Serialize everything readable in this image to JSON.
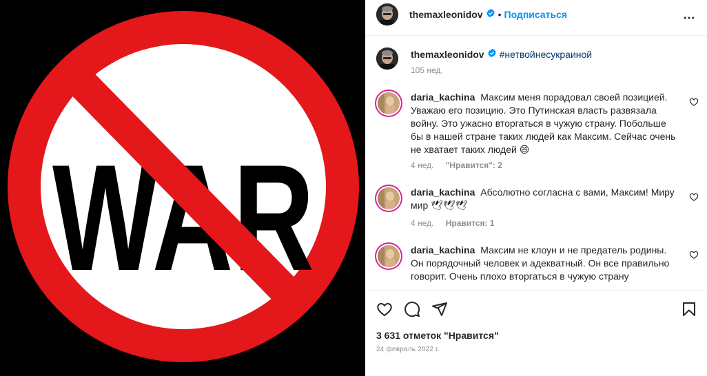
{
  "media": {
    "sign_text": "WAR",
    "colors": {
      "background": "#000000",
      "ring": "#e4171b",
      "fill": "#ffffff",
      "text": "#000000"
    }
  },
  "header": {
    "username": "themaxleonidov",
    "separator": "•",
    "follow_label": "Подписаться",
    "more_icon": "more-horizontal-icon"
  },
  "caption": {
    "username": "themaxleonidov",
    "text": "#нетвойнесукраиной",
    "time": "105 нед."
  },
  "comments": [
    {
      "username": "daria_kachina",
      "text": "Максим меня порадовал своей позицией. Уважаю его позицию. Это Путинская власть развязала войну. Это ужасно вторгаться в чужую страну. Побольше бы в нашей стране таких людей как Максим. Сейчас очень не хватает таких людей 😄",
      "time": "4 нед.",
      "likes": "\"Нравится\": 2"
    },
    {
      "username": "daria_kachina",
      "text": "Абсолютно согласна с вами, Максим! Миру мир 🕊🕊🕊",
      "time": "4 нед.",
      "likes": "Нравится: 1"
    },
    {
      "username": "daria_kachina",
      "text": "Максим не клоун и не предатель родины. Он порядочный человек и адекватный. Он все правильно говорит. Очень плохо вторгаться в чужую страну",
      "time": "",
      "likes": ""
    }
  ],
  "actions": {
    "like_icon": "heart-icon",
    "comment_icon": "comment-icon",
    "share_icon": "send-icon",
    "save_icon": "bookmark-icon"
  },
  "likes_count": "3 631 отметок \"Нравится\"",
  "date": "24 февраль 2022 г.",
  "colors": {
    "accent": "#0095f6",
    "hashtag": "#00376b",
    "muted": "#8e8e8e"
  }
}
